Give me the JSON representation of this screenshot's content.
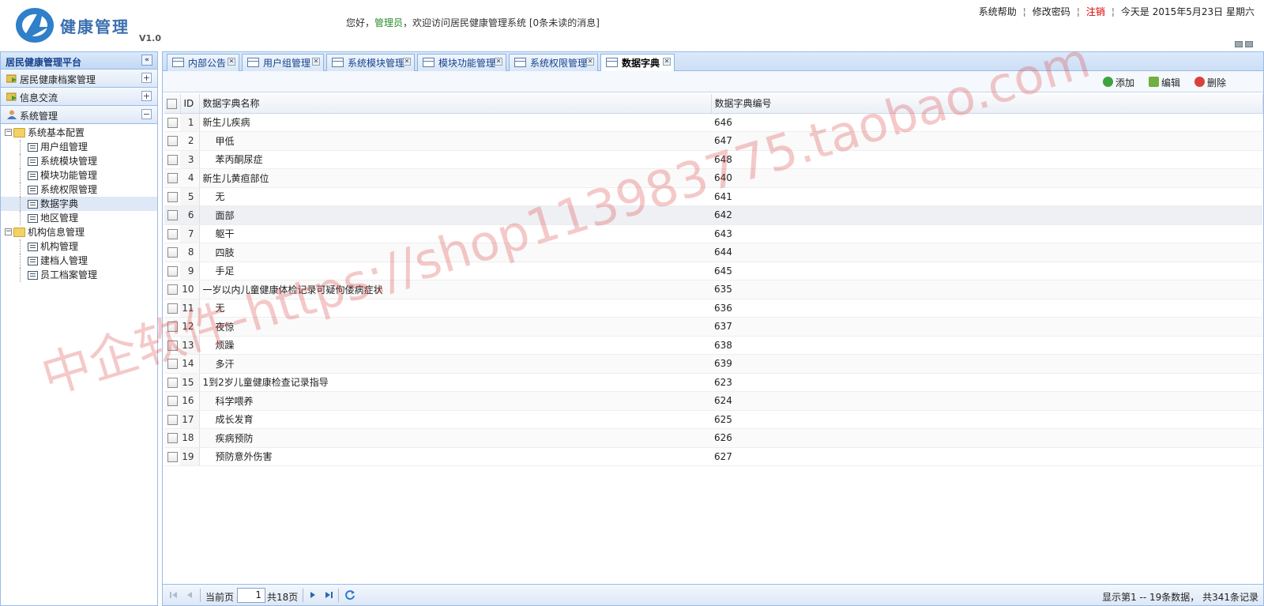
{
  "header": {
    "logo_text": "健康管理",
    "version": "V1.0",
    "greeting_prefix": "您好，",
    "role": "管理员",
    "greeting_suffix": "，欢迎访问居民健康管理系统",
    "unread": "[0条未读的消息]",
    "help": "系统帮助",
    "change_password": "修改密码",
    "logout": "注销",
    "today": "今天是 2015年5月23日 星期六"
  },
  "sidebar": {
    "title": "居民健康管理平台",
    "collapse_icon": "«",
    "sections": [
      {
        "label": "居民健康档案管理",
        "toggle": "+"
      },
      {
        "label": "信息交流",
        "toggle": "+"
      },
      {
        "label": "系统管理",
        "toggle": "−"
      }
    ],
    "tree": [
      {
        "label": "系统基本配置",
        "expander": "−"
      },
      {
        "label": "用户组管理"
      },
      {
        "label": "系统模块管理"
      },
      {
        "label": "模块功能管理"
      },
      {
        "label": "系统权限管理"
      },
      {
        "label": "数据字典"
      },
      {
        "label": "地区管理"
      },
      {
        "label": "机构信息管理",
        "expander": "−"
      },
      {
        "label": "机构管理"
      },
      {
        "label": "建档人管理"
      },
      {
        "label": "员工档案管理"
      }
    ]
  },
  "tabs": [
    {
      "label": "内部公告"
    },
    {
      "label": "用户组管理"
    },
    {
      "label": "系统模块管理"
    },
    {
      "label": "模块功能管理"
    },
    {
      "label": "系统权限管理"
    },
    {
      "label": "数据字典"
    }
  ],
  "toolbar": {
    "add": "添加",
    "edit": "编辑",
    "delete": "删除"
  },
  "grid": {
    "columns": {
      "id": "ID",
      "name": "数据字典名称",
      "code": "数据字典编号"
    },
    "rows": [
      {
        "id": "1",
        "name": "新生儿疾病",
        "code": "646"
      },
      {
        "id": "2",
        "name": "甲低",
        "code": "647"
      },
      {
        "id": "3",
        "name": "苯丙酮尿症",
        "code": "648"
      },
      {
        "id": "4",
        "name": "新生儿黄疸部位",
        "code": "640"
      },
      {
        "id": "5",
        "name": "无",
        "code": "641"
      },
      {
        "id": "6",
        "name": "面部",
        "code": "642"
      },
      {
        "id": "7",
        "name": "躯干",
        "code": "643"
      },
      {
        "id": "8",
        "name": "四肢",
        "code": "644"
      },
      {
        "id": "9",
        "name": "手足",
        "code": "645"
      },
      {
        "id": "10",
        "name": "一岁以内儿童健康体检记录可疑佝偻病症状",
        "code": "635"
      },
      {
        "id": "11",
        "name": "无",
        "code": "636"
      },
      {
        "id": "12",
        "name": "夜惊",
        "code": "637"
      },
      {
        "id": "13",
        "name": "烦躁",
        "code": "638"
      },
      {
        "id": "14",
        "name": "多汗",
        "code": "639"
      },
      {
        "id": "15",
        "name": "1到2岁儿童健康检查记录指导",
        "code": "623"
      },
      {
        "id": "16",
        "name": "科学喂养",
        "code": "624"
      },
      {
        "id": "17",
        "name": "成长发育",
        "code": "625"
      },
      {
        "id": "18",
        "name": "疾病预防",
        "code": "626"
      },
      {
        "id": "19",
        "name": "预防意外伤害",
        "code": "627"
      }
    ]
  },
  "pager": {
    "current_label": "当前页",
    "page": "1",
    "total": "共18页",
    "summary": "显示第1 -- 19条数据， 共341条记录"
  },
  "watermark": "中企软件-https://shop113983775.taobao.com",
  "colors": {
    "accent": "#15428b",
    "border": "#99bbe8",
    "logout": "#dd0000",
    "role": "#2a8c2a"
  }
}
